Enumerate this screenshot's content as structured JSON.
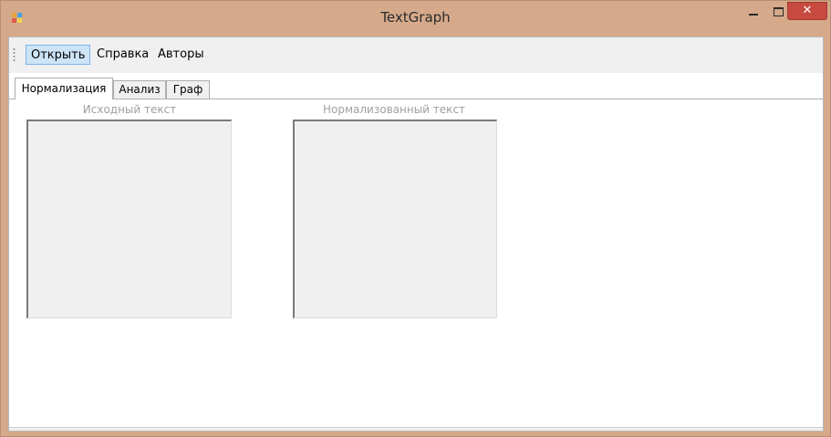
{
  "window": {
    "title": "TextGraph",
    "close_glyph": "✕",
    "icons": {
      "app": "app-icon",
      "minimize": "minimize-icon",
      "maximize": "maximize-icon",
      "close": "close-icon"
    }
  },
  "menu": {
    "items": [
      {
        "label": "Открыть",
        "active": true
      },
      {
        "label": "Справка",
        "active": false
      },
      {
        "label": "Авторы",
        "active": false
      }
    ]
  },
  "tabs": [
    {
      "label": "Нормализация",
      "active": true
    },
    {
      "label": "Анализ",
      "active": false
    },
    {
      "label": "Граф",
      "active": false
    }
  ],
  "normalization": {
    "source_label": "Исходный текст",
    "source_text": "",
    "normalized_label": "Нормализованный текст",
    "normalized_text": ""
  },
  "colors": {
    "title_bar": "#d5a98a",
    "close_button": "#c74a40",
    "menu_highlight": "#cde4f7",
    "textbox_bg": "#f0f0f0"
  }
}
